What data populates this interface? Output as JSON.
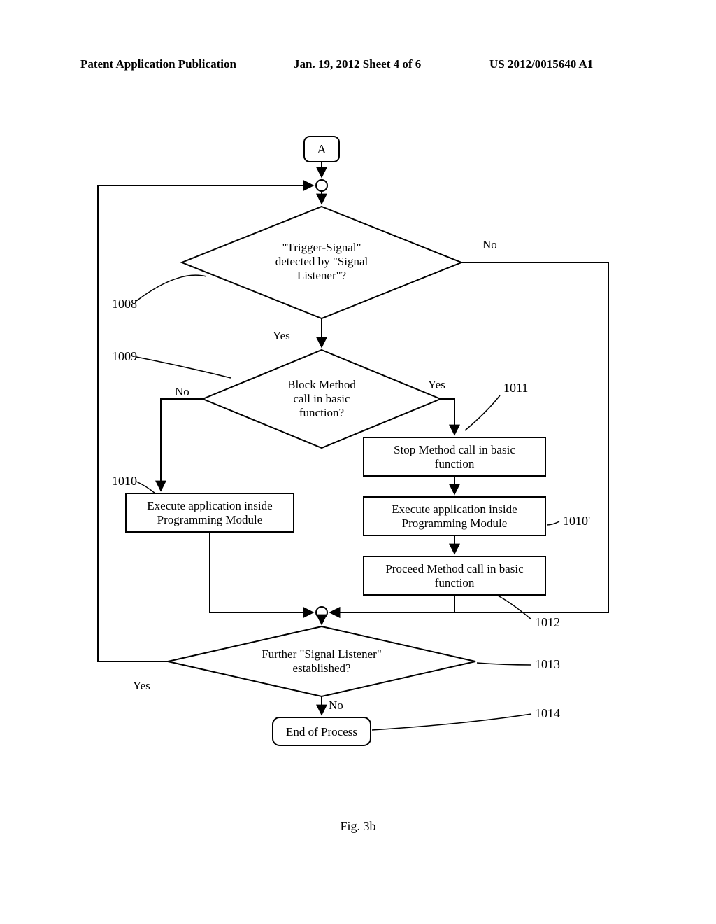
{
  "header": {
    "left": "Patent Application Publication",
    "mid": "Jan. 19, 2012  Sheet 4 of 6",
    "right": "US 2012/0015640 A1"
  },
  "connector": {
    "a": "A"
  },
  "decisions": {
    "d1008": {
      "l1": "\"Trigger-Signal\"",
      "l2": "detected by \"Signal",
      "l3": "Listener\"?",
      "yes": "Yes",
      "no": "No"
    },
    "d1009": {
      "l1": "Block Method",
      "l2": "call in basic",
      "l3": "function?",
      "yes": "Yes",
      "no": "No"
    },
    "d1013": {
      "l1": "Further \"Signal Listener\"",
      "l2": "established?",
      "yes": "Yes",
      "no": "No"
    }
  },
  "boxes": {
    "b1010": {
      "l1": "Execute application inside",
      "l2": "Programming Module"
    },
    "b1011": {
      "l1": "Stop Method call in basic",
      "l2": "function"
    },
    "b1010p": {
      "l1": "Execute application inside",
      "l2": "Programming Module"
    },
    "b1012": {
      "l1": "Proceed Method call in basic",
      "l2": "function"
    },
    "end": {
      "l1": "End of Process"
    }
  },
  "labels": {
    "n1008": "1008",
    "n1009": "1009",
    "n1010": "1010",
    "n1011": "1011",
    "n1010p": "1010'",
    "n1012": "1012",
    "n1013": "1013",
    "n1014": "1014"
  },
  "figure": "Fig. 3b",
  "chart_data": {
    "type": "flowchart",
    "nodes": [
      {
        "id": "A",
        "type": "connector",
        "label": "A"
      },
      {
        "id": "J1",
        "type": "junction"
      },
      {
        "id": "1008",
        "type": "decision",
        "text": "\"Trigger-Signal\" detected by \"Signal Listener\"?"
      },
      {
        "id": "1009",
        "type": "decision",
        "text": "Block Method call in basic function?"
      },
      {
        "id": "1010",
        "type": "process",
        "text": "Execute application inside Programming Module"
      },
      {
        "id": "1011",
        "type": "process",
        "text": "Stop Method call in basic function"
      },
      {
        "id": "1010'",
        "type": "process",
        "text": "Execute application inside Programming Module"
      },
      {
        "id": "1012",
        "type": "process",
        "text": "Proceed Method call in basic function"
      },
      {
        "id": "J2",
        "type": "junction"
      },
      {
        "id": "1013",
        "type": "decision",
        "text": "Further \"Signal Listener\" established?"
      },
      {
        "id": "1014",
        "type": "terminator",
        "text": "End of Process"
      }
    ],
    "edges": [
      {
        "from": "A",
        "to": "J1"
      },
      {
        "from": "J1",
        "to": "1008"
      },
      {
        "from": "1008",
        "to": "1009",
        "label": "Yes"
      },
      {
        "from": "1008",
        "to": "J2",
        "label": "No"
      },
      {
        "from": "1009",
        "to": "1010",
        "label": "No"
      },
      {
        "from": "1009",
        "to": "1011",
        "label": "Yes"
      },
      {
        "from": "1011",
        "to": "1010'"
      },
      {
        "from": "1010'",
        "to": "1012"
      },
      {
        "from": "1010",
        "to": "J2"
      },
      {
        "from": "1012",
        "to": "J2"
      },
      {
        "from": "J2",
        "to": "1013"
      },
      {
        "from": "1013",
        "to": "J1",
        "label": "Yes"
      },
      {
        "from": "1013",
        "to": "1014",
        "label": "No"
      }
    ]
  }
}
